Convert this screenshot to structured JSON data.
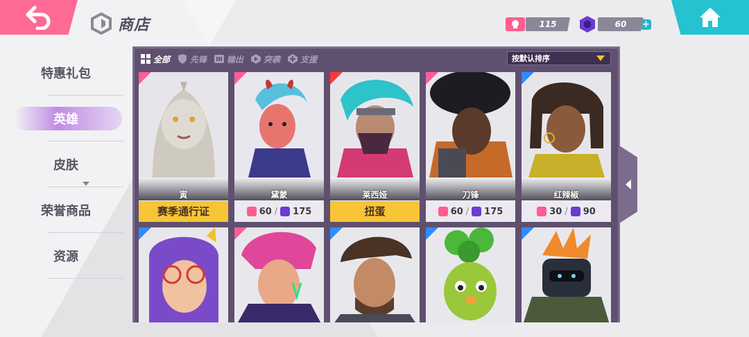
{
  "header": {
    "title": "商店",
    "currency_tickets": "115",
    "currency_gems": "60"
  },
  "sidebar": {
    "items": [
      {
        "label": "特惠礼包",
        "active": false
      },
      {
        "label": "英雄",
        "active": true
      },
      {
        "label": "皮肤",
        "active": false
      },
      {
        "label": "荣誉商品",
        "active": false
      },
      {
        "label": "资源",
        "active": false
      }
    ]
  },
  "filters": [
    {
      "label": "全部",
      "icon": "grid-icon",
      "active": true
    },
    {
      "label": "先锋",
      "icon": "shield-icon",
      "active": false
    },
    {
      "label": "输出",
      "icon": "gun-icon",
      "active": false
    },
    {
      "label": "突袭",
      "icon": "assault-icon",
      "active": false
    },
    {
      "label": "支援",
      "icon": "support-icon",
      "active": false
    }
  ],
  "sort": {
    "label": "按默认排序"
  },
  "heroes_row1": [
    {
      "name": "寅",
      "type": "label",
      "label": "赛季通行证",
      "corner": "#ff5d97"
    },
    {
      "name": "黛蒙",
      "type": "price",
      "ticket": "60",
      "gem": "175",
      "corner": "#ff5d97"
    },
    {
      "name": "莱西娅",
      "type": "label",
      "label": "扭蛋",
      "corner": "#ff3a3a"
    },
    {
      "name": "刀锋",
      "type": "price",
      "ticket": "60",
      "gem": "175",
      "corner": "#ff5d97"
    },
    {
      "name": "红辣椒",
      "type": "price",
      "ticket": "30",
      "gem": "90",
      "corner": "#2f8bff"
    }
  ],
  "heroes_row2": [
    {
      "corner": "#2f8bff"
    },
    {
      "corner": "#ff5d97"
    },
    {
      "corner": "#2f8bff"
    },
    {
      "corner": "#2f8bff"
    },
    {
      "corner": "#2f8bff"
    }
  ],
  "colors": {
    "back": "#ff6a95",
    "home": "#25c3cf",
    "panel": "#605070",
    "gold": "#f7c536"
  },
  "price_separator": "/"
}
